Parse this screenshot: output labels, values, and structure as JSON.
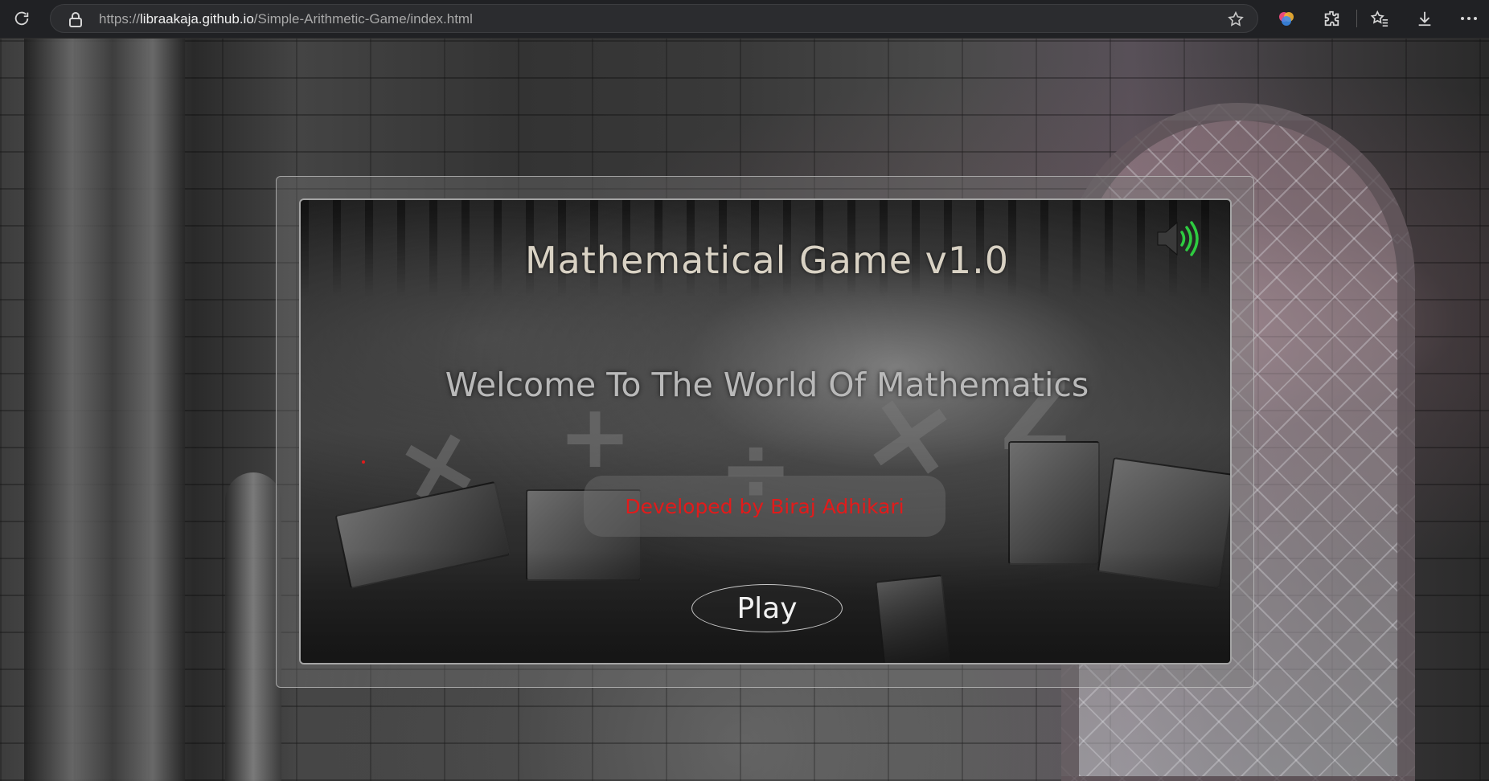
{
  "browser": {
    "url_scheme": "https://",
    "url_host": "libraakaja.github.io",
    "url_path": "/Simple-Arithmetic-Game/index.html",
    "icons": [
      "refresh-icon",
      "lock-icon",
      "favorite-star-icon",
      "copilot-icon",
      "extensions-icon",
      "favorites-icon",
      "downloads-icon",
      "more-icon"
    ]
  },
  "game": {
    "title": "Mathematical Game v1.0",
    "welcome": "Welcome To The World Of Mathematics",
    "developer": "Developed by Biraj Adhikari",
    "play_label": "Play",
    "sound_icon": "speaker-icon",
    "colors": {
      "title": "#d9d2c4",
      "developer_text": "#e11b1b",
      "sound_waves": "#2ecc40"
    }
  }
}
